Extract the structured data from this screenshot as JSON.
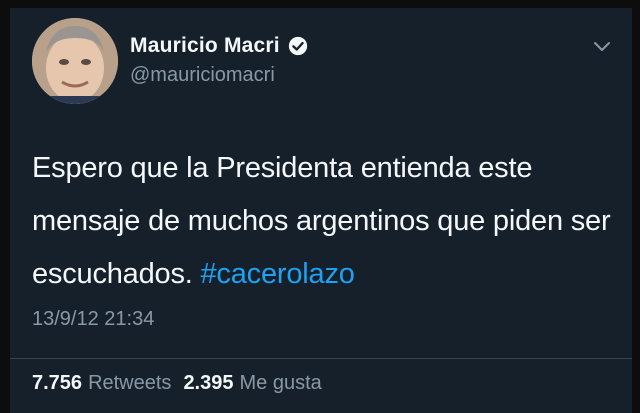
{
  "user": {
    "display_name": "Mauricio Macri",
    "handle": "@mauriciomacri",
    "verified": true,
    "avatar_icon": "profile-photo"
  },
  "tweet": {
    "text": "Espero que la Presidenta entienda este mensaje de muchos argentinos que piden ser escuchados.",
    "hashtag": "#cacerolazo",
    "timestamp": "13/9/12 21:34"
  },
  "stats": {
    "retweets_count": "7.756",
    "retweets_label": "Retweets",
    "likes_count": "2.395",
    "likes_label": "Me gusta"
  },
  "colors": {
    "background": "#15202b",
    "accent": "#1da1f2",
    "text_primary": "#f5f8fa",
    "text_secondary": "#8899a6"
  },
  "icons": {
    "verified": "verified-badge-icon",
    "menu": "chevron-down-icon"
  }
}
